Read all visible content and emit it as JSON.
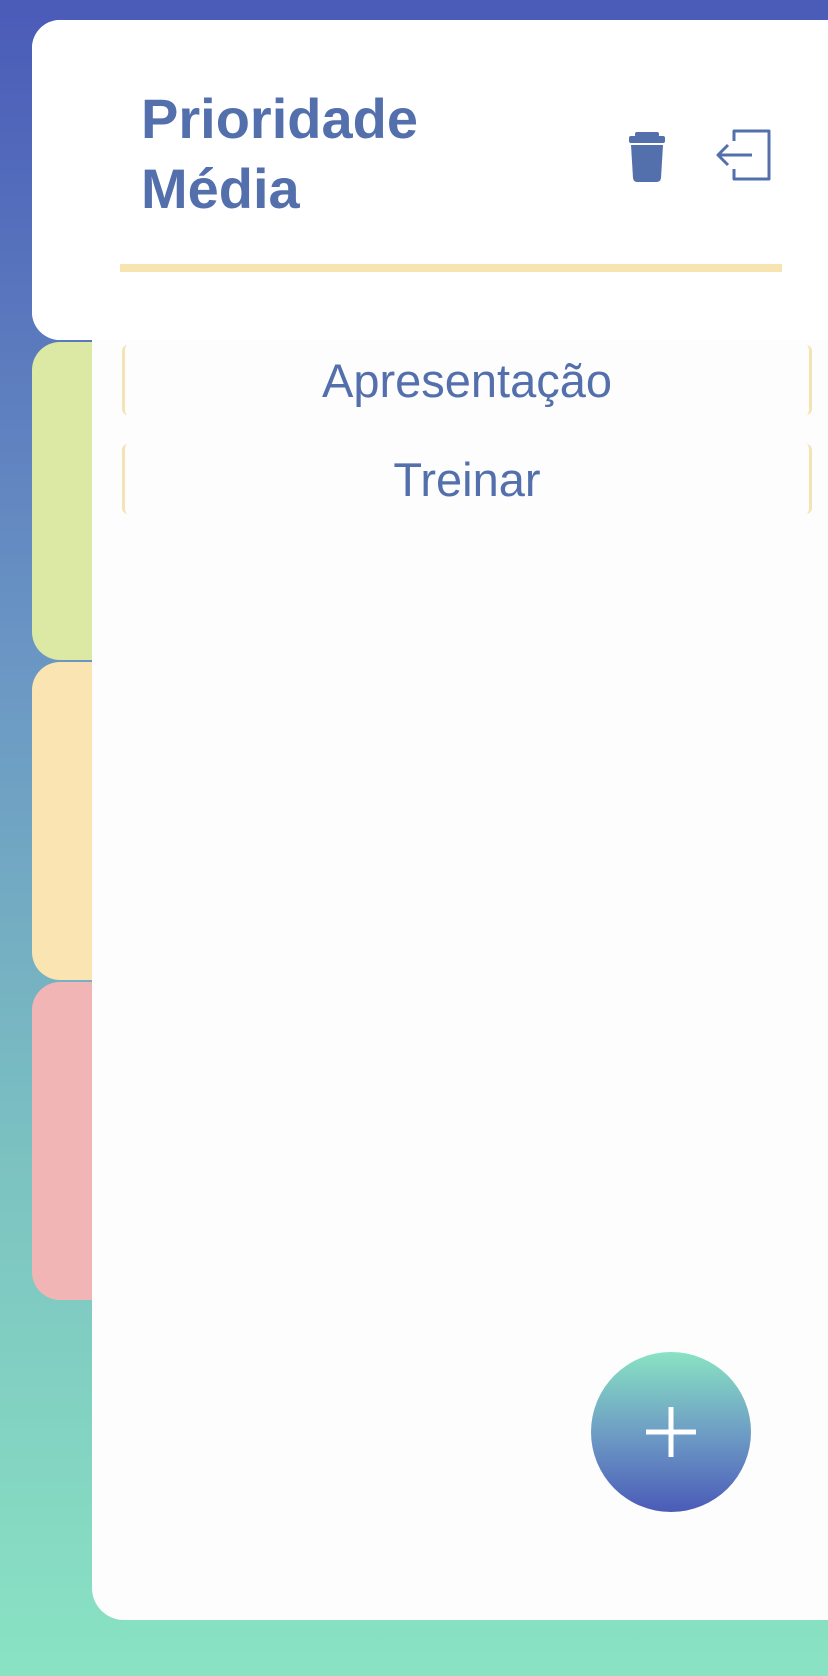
{
  "header": {
    "title_line1": "Prioridade",
    "title_line2": "Média",
    "icons": [
      "trash-icon",
      "exit-icon"
    ]
  },
  "tasks": [
    {
      "label": "Apresentação"
    },
    {
      "label": "Treinar"
    }
  ],
  "fab": {
    "icon": "plus-icon"
  },
  "colors": {
    "accent_text": "#5370ad",
    "divider": "#f8e4b0",
    "tab_green": "#dbe9a4",
    "tab_yellow": "#f9e4b2",
    "tab_red": "#f2b5b5",
    "gradient_top": "#4a5bb8",
    "gradient_bottom": "#89e3c3"
  }
}
